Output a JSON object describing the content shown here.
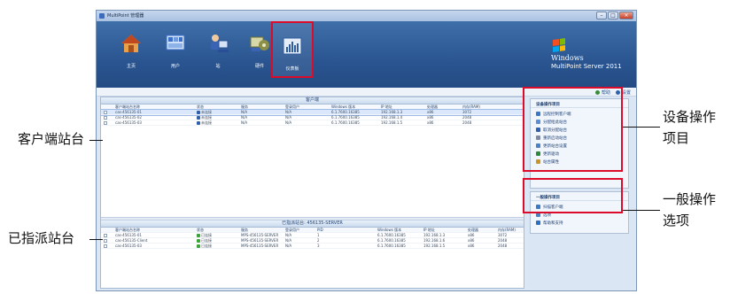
{
  "window": {
    "title": "MultiPoint 管理器"
  },
  "ribbon": {
    "tools": [
      {
        "key": "home",
        "label": "主页",
        "color": "#c75a24"
      },
      {
        "key": "users",
        "label": "用户",
        "color": "#3c6fc8"
      },
      {
        "key": "stations",
        "label": "站",
        "color": "#3b63b3"
      },
      {
        "key": "hardware",
        "label": "硬件",
        "color": "#8b8f48"
      },
      {
        "key": "dashboard",
        "label": "仪表板",
        "color": "#2f5c9c",
        "selected": true
      }
    ],
    "brand": {
      "line1": "Windows",
      "line2": "MultiPoint Server 2011"
    }
  },
  "strip": {
    "help_link": "帮助",
    "settings_link": "设置"
  },
  "client_panel": {
    "title": "客户端",
    "columns": [
      "客户端站台名称",
      "状态",
      "服务",
      "登录用户",
      "Windows 版本",
      "IP 地址",
      "处理器",
      "内存(RAM)"
    ],
    "rows": [
      [
        "cas-456135-01",
        "未连接",
        "N/A",
        "N/A",
        "6.1.7600.16385",
        "192.168.1.3",
        "x86",
        "3072"
      ],
      [
        "cas-456135-02",
        "未连接",
        "N/A",
        "N/A",
        "6.1.7600.16385",
        "192.168.1.4",
        "x86",
        "2048"
      ],
      [
        "cas-456135-03",
        "未连接",
        "N/A",
        "N/A",
        "6.1.7600.16385",
        "192.168.1.5",
        "x86",
        "2048"
      ]
    ]
  },
  "assigned_panel": {
    "title": "已指派站台: 456135-SERVER",
    "columns": [
      "客户端站台名称",
      "状态",
      "服务",
      "登录用户",
      "PID",
      "Windows 版本",
      "IP 地址",
      "处理器",
      "内存(RAM)"
    ],
    "rows": [
      [
        "cas-456135-01",
        "已连接",
        "MPS-456135-SERVER",
        "N/A",
        "1",
        "6.1.7600.16385",
        "192.168.1.3",
        "x86",
        "3072"
      ],
      [
        "cas-456135-Client",
        "已连接",
        "MPS-456135-SERVER",
        "N/A",
        "2",
        "6.1.7600.16385",
        "192.168.1.6",
        "x86",
        "2048"
      ],
      [
        "cas-456135-03",
        "已连接",
        "MPS-456135-SERVER",
        "N/A",
        "3",
        "6.1.7600.16385",
        "192.168.1.5",
        "x86",
        "2048"
      ]
    ]
  },
  "device_tasks": {
    "title": "设备操作项目",
    "items": [
      {
        "label": "远程控制客户端",
        "color": "#3a78c8"
      },
      {
        "label": "分配给此站台",
        "color": "#5a8fd6"
      },
      {
        "label": "取消分配站台",
        "color": "#2e62b1"
      },
      {
        "label": "重新启动站台",
        "color": "#7c8aa3"
      },
      {
        "label": "更新站台设置",
        "color": "#4a82c8"
      },
      {
        "label": "更新驱动",
        "color": "#2c8a3c"
      },
      {
        "label": "站台属性",
        "color": "#c79528"
      }
    ]
  },
  "general_tasks": {
    "title": "一般操作项目",
    "items": [
      {
        "label": "扫描客户端",
        "color": "#3a78c8"
      },
      {
        "label": "选项",
        "color": "#4a82c8"
      },
      {
        "label": "帮助和支持",
        "color": "#2c6fbf"
      }
    ]
  },
  "annotations": {
    "device": [
      "设备操作",
      "项目"
    ],
    "general": [
      "一般操作",
      "选项"
    ],
    "clients": "客户端站台",
    "assigned": "已指派站台"
  },
  "colors": {
    "highlight": "#dd0b2a",
    "status_offline": "#2e5fa8",
    "status_online": "#3aa33a"
  }
}
